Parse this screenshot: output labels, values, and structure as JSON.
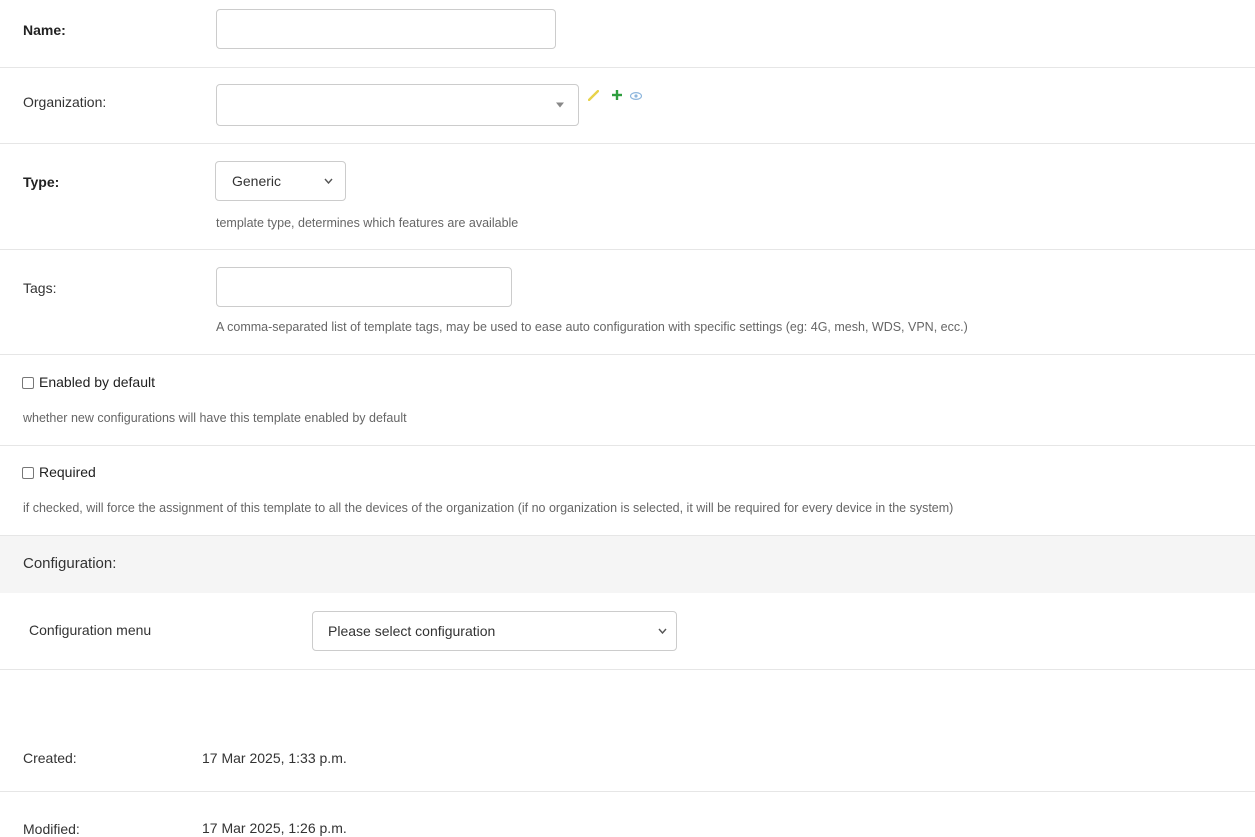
{
  "fields": {
    "name": {
      "label": "Name:",
      "value": ""
    },
    "organization": {
      "label": "Organization:",
      "value": ""
    },
    "type": {
      "label": "Type:",
      "value": "Generic",
      "help": "template type, determines which features are available"
    },
    "tags": {
      "label": "Tags:",
      "value": "",
      "help": "A comma-separated list of template tags, may be used to ease auto configuration with specific settings (eg: 4G, mesh, WDS, VPN, ecc.)"
    },
    "enabled_by_default": {
      "label": "Enabled by default",
      "help": "whether new configurations will have this template enabled by default"
    },
    "required": {
      "label": "Required",
      "help": "if checked, will force the assignment of this template to all the devices of the organization (if no organization is selected, it will be required for every device in the system)"
    }
  },
  "configuration": {
    "header": "Configuration:",
    "menu_label": "Configuration menu",
    "menu_value": "Please select configuration"
  },
  "meta": {
    "created_label": "Created:",
    "created_value": "17 Mar 2025, 1:33 p.m.",
    "modified_label": "Modified:",
    "modified_value": "17 Mar 2025, 1:26 p.m."
  },
  "icons": {
    "edit": "pencil-icon",
    "add": "plus-icon",
    "view": "eye-icon"
  },
  "colors": {
    "edit_icon": "#e8d34a",
    "add_icon": "#2e9e3e",
    "view_icon": "#8fb7dd",
    "config_header_bg": "#f5f5f5"
  }
}
